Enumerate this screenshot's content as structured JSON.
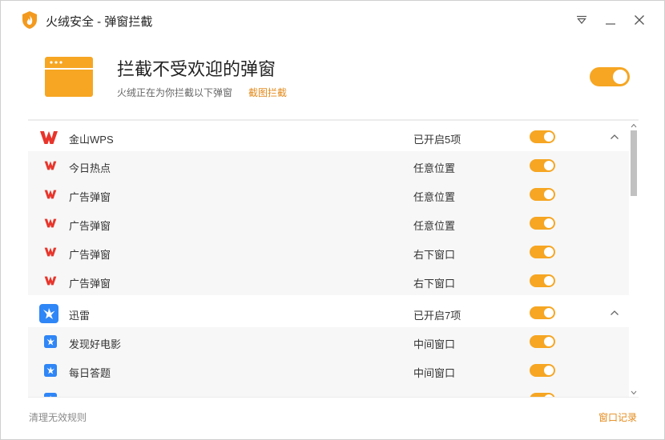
{
  "window": {
    "title": "火绒安全 - 弹窗拦截"
  },
  "header": {
    "title": "拦截不受欢迎的弹窗",
    "subtitle": "火绒正在为你拦截以下弹窗",
    "link_label": "截图拦截",
    "master_toggle_on": true
  },
  "groups": [
    {
      "name": "金山WPS",
      "icon": "wps-icon",
      "status": "已开启5项",
      "enabled": true,
      "expanded": true,
      "items": [
        {
          "name": "今日热点",
          "position": "任意位置",
          "enabled": true
        },
        {
          "name": "广告弹窗",
          "position": "任意位置",
          "enabled": true
        },
        {
          "name": "广告弹窗",
          "position": "任意位置",
          "enabled": true
        },
        {
          "name": "广告弹窗",
          "position": "右下窗口",
          "enabled": true
        },
        {
          "name": "广告弹窗",
          "position": "右下窗口",
          "enabled": true
        }
      ]
    },
    {
      "name": "迅雷",
      "icon": "xunlei-icon",
      "status": "已开启7项",
      "enabled": true,
      "expanded": true,
      "items": [
        {
          "name": "发现好电影",
          "position": "中间窗口",
          "enabled": true
        },
        {
          "name": "每日答题",
          "position": "中间窗口",
          "enabled": true
        }
      ]
    }
  ],
  "footer": {
    "clean_label": "清理无效规则",
    "records_label": "窗口记录"
  },
  "colors": {
    "accent": "#f6a623",
    "link": "#e38a1b",
    "wps": "#e8352b",
    "xunlei": "#2f86f6"
  }
}
